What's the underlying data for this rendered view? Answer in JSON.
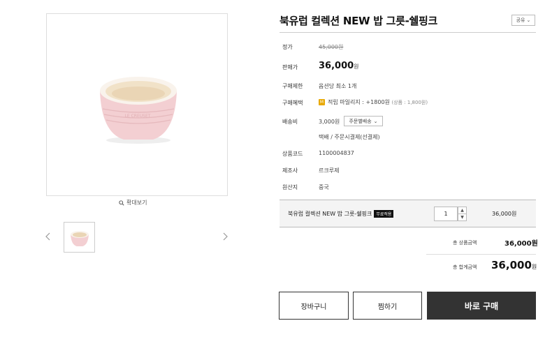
{
  "product": {
    "title": "북유럽 컬렉션 NEW 밥 그릇-쉘핑크",
    "share_label": "공유",
    "zoom_label": "확대보기",
    "colors": {
      "bowl_pink": "#f3cfd2",
      "bowl_rim": "#f7eadf",
      "accent_dark": "#333333",
      "point_badge": "#e8a800"
    }
  },
  "info": {
    "list_price_label": "정가",
    "list_price": "45,000원",
    "sale_price_label": "판매가",
    "sale_price": "36,000",
    "sale_price_unit": "원",
    "purchase_limit_label": "구매제한",
    "purchase_limit": "옵션당 최소 1개",
    "benefit_label": "구매혜택",
    "benefit_badge": "M",
    "benefit": "적립 마일리지 : +1800원",
    "benefit_note": "(상품 : 1,800원)",
    "shipping_label": "배송비",
    "shipping_fee": "3,000원",
    "shipping_option": "주문별배송",
    "shipping_method": "택배  /  주문시결제(선결제)",
    "product_code_label": "상품코드",
    "product_code": "1100004837",
    "maker_label": "제조사",
    "maker": "르크루제",
    "origin_label": "원산지",
    "origin": "중국"
  },
  "option": {
    "name": "북유럽 컬렉션 NEW 밥 그릇-쉘핑크",
    "badge": "무료적용",
    "quantity": "1",
    "price": "36,000원"
  },
  "summary": {
    "product_total_label": "총 상품금액",
    "product_total": "36,000원",
    "grand_total_label": "총 합계금액",
    "grand_total": "36,000",
    "grand_total_unit": "원"
  },
  "buttons": {
    "cart": "장바구니",
    "wish": "찜하기",
    "buy": "바로 구매"
  }
}
